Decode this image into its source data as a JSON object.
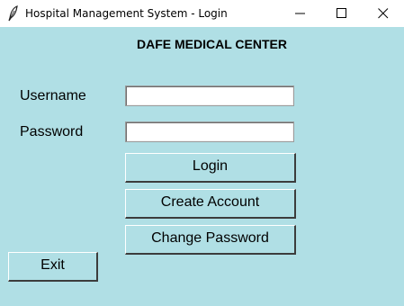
{
  "window": {
    "title": "Hospital Management System - Login",
    "controls": [
      "minimize-icon",
      "maximize-icon",
      "close-icon"
    ]
  },
  "form": {
    "heading": "DAFE MEDICAL CENTER",
    "username_label": "Username",
    "username_value": "",
    "password_label": "Password",
    "password_value": ""
  },
  "buttons": {
    "login": "Login",
    "create_account": "Create Account",
    "change_password": "Change Password",
    "exit": "Exit"
  },
  "colors": {
    "background": "#b0dfe5",
    "titlebar": "#ffffff"
  }
}
